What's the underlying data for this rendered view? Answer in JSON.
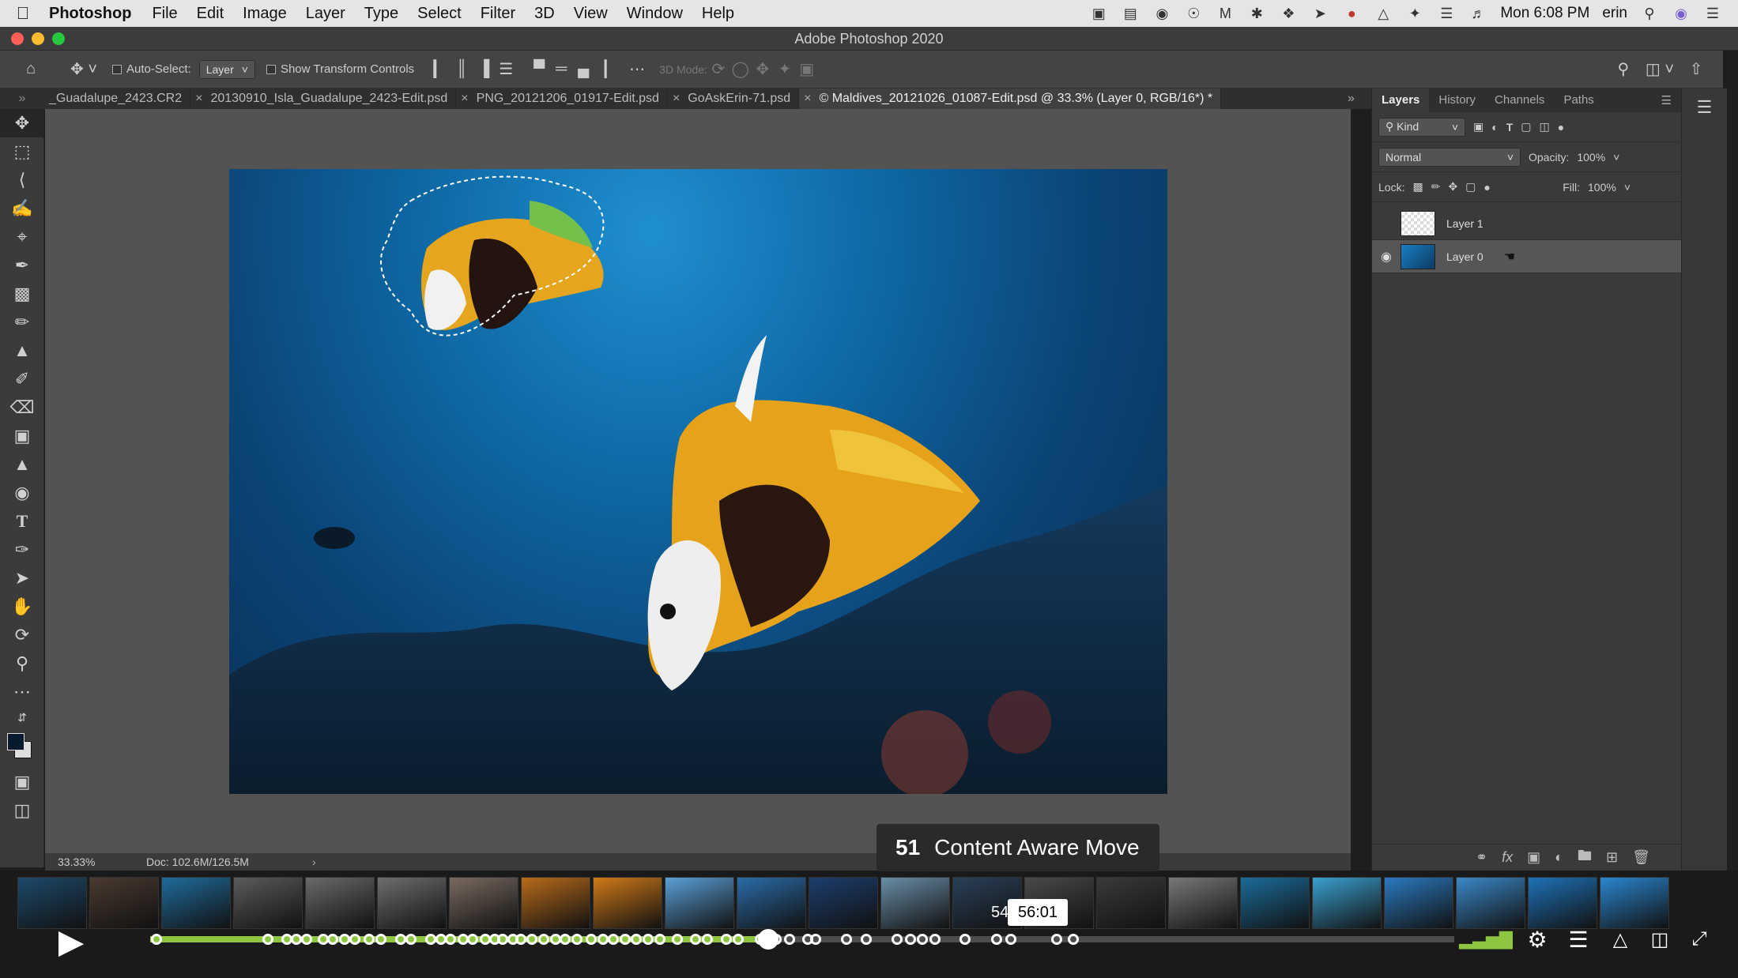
{
  "menubar": {
    "app_name": "Photoshop",
    "items": [
      "File",
      "Edit",
      "Image",
      "Layer",
      "Type",
      "Select",
      "Filter",
      "3D",
      "View",
      "Window",
      "Help"
    ],
    "clock": "Mon 6:08 PM",
    "user": "erin"
  },
  "window": {
    "title": "Adobe Photoshop 2020"
  },
  "options_bar": {
    "auto_select_label": "Auto-Select:",
    "auto_select_value": "Layer",
    "transform_label": "Show Transform Controls",
    "mode_label": "3D Mode:"
  },
  "doc_tabs": [
    {
      "label": "_Guadalupe_2423.CR2"
    },
    {
      "label": "20130910_Isla_Guadalupe_2423-Edit.psd"
    },
    {
      "label": "PNG_20121206_01917-Edit.psd"
    },
    {
      "label": "GoAskErin-71.psd"
    },
    {
      "label": "© Maldives_20121026_01087-Edit.psd @ 33.3% (Layer 0, RGB/16*) *"
    }
  ],
  "status": {
    "zoom": "33.33%",
    "doc": "Doc: 102.6M/126.5M"
  },
  "layers_panel": {
    "tabs": [
      "Layers",
      "History",
      "Channels",
      "Paths"
    ],
    "kind_label": "Kind",
    "blend_mode": "Normal",
    "opacity_label": "Opacity:",
    "opacity_value": "100%",
    "lock_label": "Lock:",
    "fill_label": "Fill:",
    "fill_value": "100%",
    "layers": [
      {
        "name": "Layer 1",
        "visible": false,
        "selected": false
      },
      {
        "name": "Layer 0",
        "visible": true,
        "selected": true
      }
    ]
  },
  "player": {
    "chapter_number": "51",
    "chapter_title": "Content Aware Move",
    "hover_time": "56:01",
    "hover_prefix": "54",
    "progress": 0.474,
    "markers": [
      0.005,
      0.09,
      0.105,
      0.112,
      0.12,
      0.133,
      0.14,
      0.149,
      0.157,
      0.168,
      0.177,
      0.192,
      0.2,
      0.215,
      0.223,
      0.23,
      0.24,
      0.247,
      0.257,
      0.264,
      0.27,
      0.278,
      0.284,
      0.293,
      0.302,
      0.311,
      0.318,
      0.327,
      0.338,
      0.347,
      0.355,
      0.364,
      0.373,
      0.382,
      0.391,
      0.404,
      0.418,
      0.427,
      0.442,
      0.451,
      0.468,
      0.48,
      0.49,
      0.504,
      0.51,
      0.534,
      0.549,
      0.573,
      0.583,
      0.592,
      0.602,
      0.625,
      0.649,
      0.66,
      0.695,
      0.708
    ]
  },
  "colors": {
    "accent_progress": "#8dc63f",
    "panel_bg": "#3a3a3a",
    "workspace_bg": "#535353"
  }
}
